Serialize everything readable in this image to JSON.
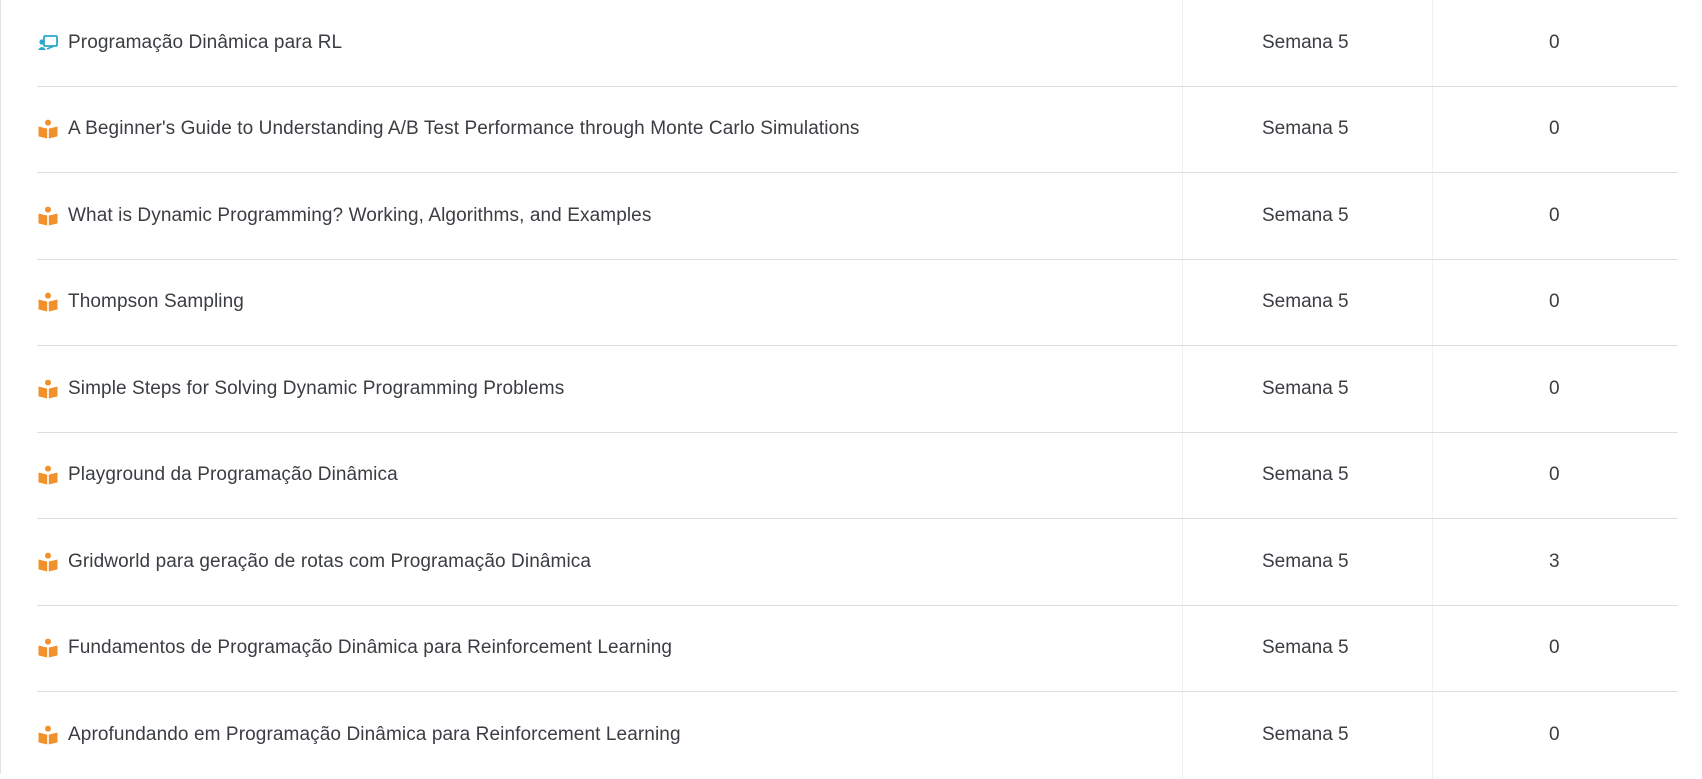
{
  "rows": [
    {
      "icon": "presentation-icon",
      "name": "Programação Dinâmica para RL",
      "week": "Semana 5",
      "count": "0"
    },
    {
      "icon": "reading-icon",
      "name": "A Beginner's Guide to Understanding A/B Test Performance through Monte Carlo Simulations",
      "week": "Semana 5",
      "count": "0"
    },
    {
      "icon": "reading-icon",
      "name": "What is Dynamic Programming? Working, Algorithms, and Examples",
      "week": "Semana 5",
      "count": "0"
    },
    {
      "icon": "reading-icon",
      "name": "Thompson Sampling",
      "week": "Semana 5",
      "count": "0"
    },
    {
      "icon": "reading-icon",
      "name": "Simple Steps for Solving Dynamic Programming Problems",
      "week": "Semana 5",
      "count": "0"
    },
    {
      "icon": "reading-icon",
      "name": "Playground da Programação Dinâmica",
      "week": "Semana 5",
      "count": "0"
    },
    {
      "icon": "reading-icon",
      "name": "Gridworld para geração de rotas com Programação Dinâmica",
      "week": "Semana 5",
      "count": "3"
    },
    {
      "icon": "reading-icon",
      "name": "Fundamentos de Programação Dinâmica para Reinforcement Learning",
      "week": "Semana 5",
      "count": "0"
    },
    {
      "icon": "reading-icon",
      "name": "Aprofundando em Programação Dinâmica para Reinforcement Learning",
      "week": "Semana 5",
      "count": "0"
    }
  ],
  "colors": {
    "presentation_icon": "#2aa7c9",
    "reading_icon": "#f0912b",
    "text": "#3a3d42",
    "divider": "#dedede"
  }
}
